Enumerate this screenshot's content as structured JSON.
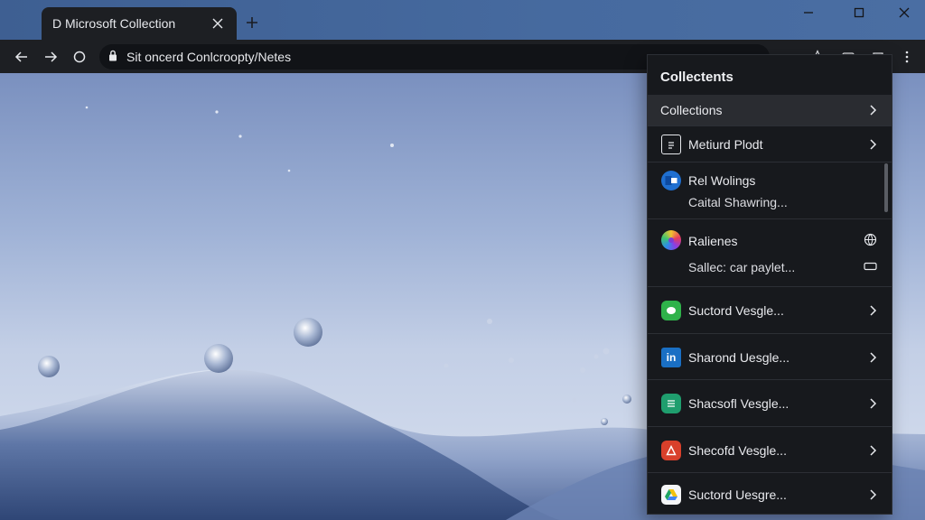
{
  "tab": {
    "title": "D Microsoft Collection"
  },
  "address_bar": {
    "url": "Sit oncerd Conlcroopty/Netes"
  },
  "panel": {
    "title": "Collectents",
    "header_row": {
      "label": "Collections"
    },
    "rows": [
      {
        "label": "Metiurd Plodt",
        "icon": "clipboard-icon"
      },
      {
        "label": "Rel Wolings",
        "sub": "Caital Shawring...",
        "icon": "outlook-icon"
      },
      {
        "label": "Ralienes",
        "sub": "Sallec: car paylet...",
        "icon": "color-wheel-icon"
      },
      {
        "label": "Suctord Vesgle...",
        "icon": "chat-icon",
        "color": "#2fb24a"
      },
      {
        "label": "Sharond Uesgle...",
        "icon": "linkedin-icon",
        "icon_text": "in",
        "color": "#1a6fc4"
      },
      {
        "label": "Shacsofl Vesgle...",
        "icon": "sheets-icon",
        "color": "#1f9e6e"
      },
      {
        "label": "Shecofd Vesgle...",
        "icon": "acrobat-icon",
        "color": "#d9402b"
      },
      {
        "label": "Suctord Uesgre...",
        "icon": "drive-icon"
      }
    ]
  },
  "colors": {
    "tab_background": "#1d1f23",
    "titlebar": "#466a9f",
    "panel_background": "#17191d",
    "header_row_highlight": "#2a2c31"
  }
}
